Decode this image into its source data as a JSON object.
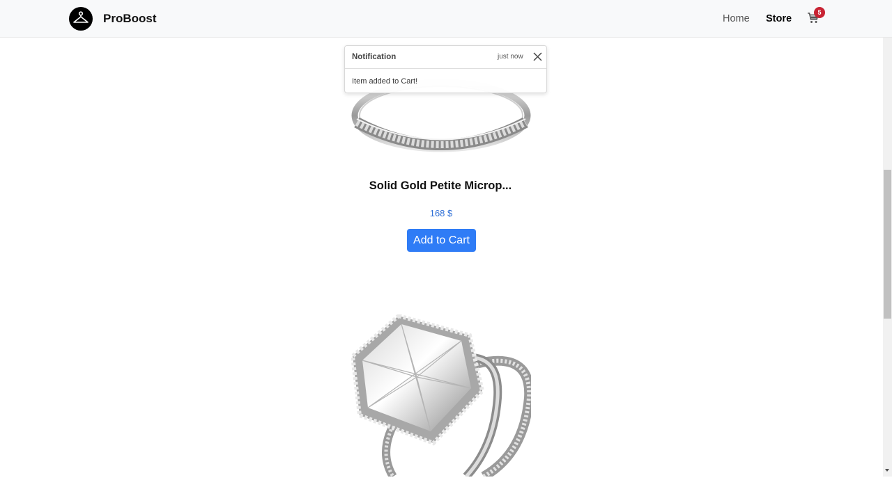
{
  "navbar": {
    "brand": "ProBoost",
    "links": [
      {
        "label": "Home",
        "active": false
      },
      {
        "label": "Store",
        "active": true
      }
    ],
    "cart_count": "5"
  },
  "notification": {
    "title": "Notification",
    "time": "just now",
    "message": "Item added to Cart!"
  },
  "products": [
    {
      "title": "Solid Gold Petite Microp...",
      "price": "168 $",
      "button": "Add to Cart",
      "image_icon": "pave-band-ring-image"
    },
    {
      "image_icon": "cushion-halo-ring-set-image"
    }
  ],
  "colors": {
    "primary": "#2f7cf6",
    "price": "#2f6fd6",
    "badge": "#c82333",
    "navbar_bg": "#f8f9fa"
  }
}
